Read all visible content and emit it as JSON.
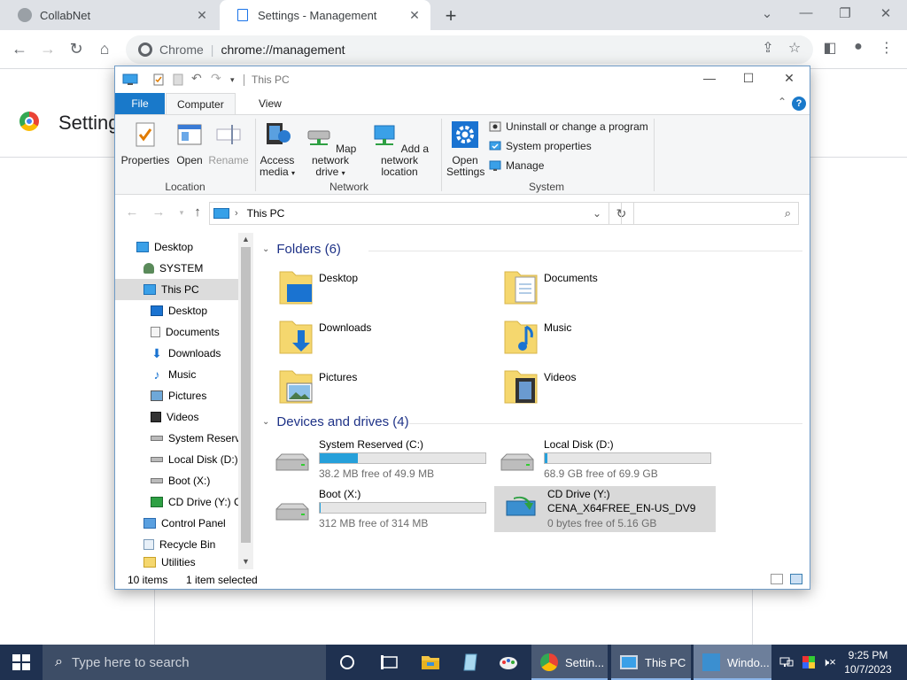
{
  "browser": {
    "tabs": [
      {
        "title": "CollabNet",
        "active": false
      },
      {
        "title": "Settings - Management",
        "active": true
      }
    ],
    "address": {
      "site_label": "Chrome",
      "url": "chrome://management"
    },
    "page_title": "Settings"
  },
  "explorer": {
    "title": "This PC",
    "ribbon_tabs": [
      "File",
      "Computer",
      "View"
    ],
    "location_group": {
      "label": "Location",
      "buttons": [
        {
          "label": "Properties",
          "enabled": true
        },
        {
          "label": "Open",
          "enabled": true
        },
        {
          "label": "Rename",
          "enabled": false
        }
      ]
    },
    "network_group": {
      "label": "Network",
      "buttons": [
        {
          "line1": "Access",
          "line2": "media"
        },
        {
          "line1": "Map network",
          "line2": "drive"
        },
        {
          "line1": "Add a network",
          "line2": "location"
        }
      ]
    },
    "system_group": {
      "label": "System",
      "open_settings": {
        "line1": "Open",
        "line2": "Settings"
      },
      "small_buttons": [
        "Uninstall or change a program",
        "System properties",
        "Manage"
      ]
    },
    "address_path": "This PC",
    "nav_items": [
      {
        "label": "Desktop",
        "level": 1,
        "icon": "desktop-icon"
      },
      {
        "label": "SYSTEM",
        "level": 2,
        "icon": "user-icon"
      },
      {
        "label": "This PC",
        "level": 2,
        "icon": "pc-icon",
        "selected": true
      },
      {
        "label": "Desktop",
        "level": 3,
        "icon": "desktop-icon"
      },
      {
        "label": "Documents",
        "level": 3,
        "icon": "documents-icon"
      },
      {
        "label": "Downloads",
        "level": 3,
        "icon": "downloads-icon"
      },
      {
        "label": "Music",
        "level": 3,
        "icon": "music-icon"
      },
      {
        "label": "Pictures",
        "level": 3,
        "icon": "pictures-icon"
      },
      {
        "label": "Videos",
        "level": 3,
        "icon": "videos-icon"
      },
      {
        "label": "System Reserve",
        "level": 3,
        "icon": "drive-icon"
      },
      {
        "label": "Local Disk (D:)",
        "level": 3,
        "icon": "drive-icon"
      },
      {
        "label": "Boot (X:)",
        "level": 3,
        "icon": "drive-icon"
      },
      {
        "label": "CD Drive (Y:) C",
        "level": 3,
        "icon": "cd-drive-icon"
      },
      {
        "label": "Control Panel",
        "level": 2,
        "icon": "control-panel-icon"
      },
      {
        "label": "Recycle Bin",
        "level": 2,
        "icon": "recycle-bin-icon"
      },
      {
        "label": "Utilities",
        "level": 2,
        "icon": "folder-icon"
      }
    ],
    "folders_header": "Folders (6)",
    "folders": [
      {
        "name": "Desktop",
        "icon": "desktop-folder-icon"
      },
      {
        "name": "Documents",
        "icon": "documents-folder-icon"
      },
      {
        "name": "Downloads",
        "icon": "downloads-folder-icon"
      },
      {
        "name": "Music",
        "icon": "music-folder-icon"
      },
      {
        "name": "Pictures",
        "icon": "pictures-folder-icon"
      },
      {
        "name": "Videos",
        "icon": "videos-folder-icon"
      }
    ],
    "drives_header": "Devices and drives (4)",
    "drives": [
      {
        "name": "System Reserved (C:)",
        "free": "38.2 MB free of 49.9 MB",
        "used_fraction": 0.23
      },
      {
        "name": "Local Disk (D:)",
        "free": "68.9 GB free of 69.9 GB",
        "used_fraction": 0.015
      },
      {
        "name": "Boot (X:)",
        "free": "312 MB free of 314 MB",
        "used_fraction": 0.006
      },
      {
        "name": "CD Drive (Y:)",
        "volume": "CENA_X64FREE_EN-US_DV9",
        "free": "0 bytes free of 5.16 GB"
      }
    ],
    "status": {
      "items": "10 items",
      "selection": "1 item selected"
    }
  },
  "taskbar": {
    "search_placeholder": "Type here to search",
    "apps": [
      {
        "label": "Settin...",
        "icon": "chrome-icon"
      },
      {
        "label": "This PC",
        "icon": "this-pc-icon"
      },
      {
        "label": "Windo...",
        "icon": "windows-setup-icon"
      }
    ],
    "time": "9:25 PM",
    "date": "10/7/2023"
  }
}
